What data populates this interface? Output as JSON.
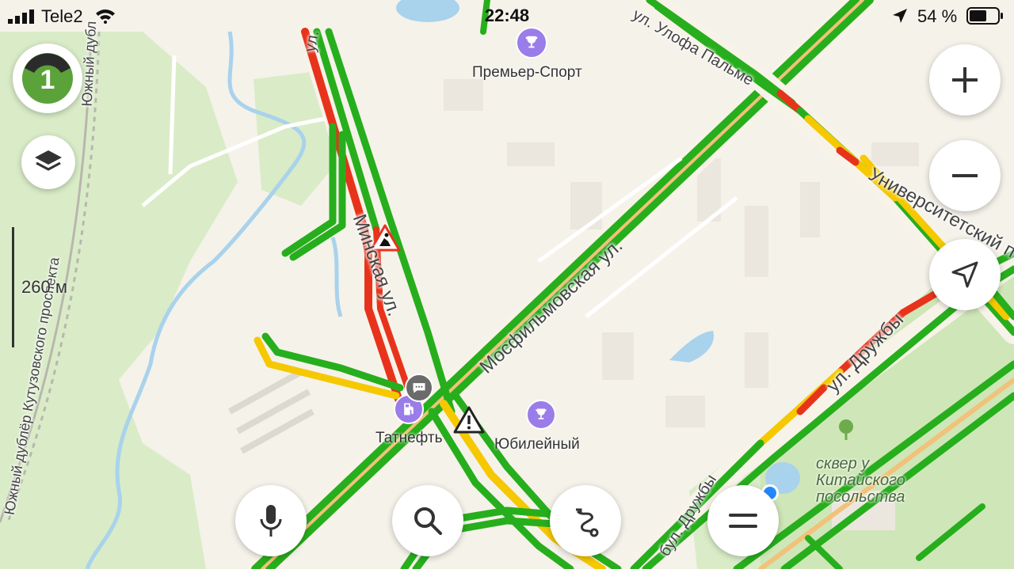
{
  "status_bar": {
    "carrier": "Tele2",
    "time": "22:48",
    "battery": "54 %"
  },
  "traffic_badge": {
    "level": "1"
  },
  "scale": {
    "label": "260 м"
  },
  "pois": {
    "premier_sport": "Премьер-Спорт",
    "tatneft": "Татнефть",
    "yubileyny": "Юбилейный",
    "park_line1": "сквер у",
    "park_line2": "Китайского",
    "park_line3": "посольства"
  },
  "streets": {
    "mosfilmovskaya": "Мосфильмовская ул.",
    "minskaya": "Минская ул.",
    "universitetsky": "Университетский п",
    "ul_druzhby": "ул. Дружбы",
    "bul_druzhby": "бул. Дружбы",
    "olof_palme": "ул. Улофа Пальме",
    "kutuzovsky_dubler": "Южный дублёр Кутузовского проспекта",
    "yuzhny_dubler": "Южный дубл",
    "ul_top": "ул."
  },
  "colors": {
    "traffic_green": "#27ae1d",
    "traffic_yellow": "#f5c800",
    "traffic_red": "#e8331c",
    "traffic_darkred": "#b51b0e",
    "poi_purple": "#9a7de8",
    "map_bg": "#f5f2ea",
    "park": "#d9ecc7",
    "water": "#a9d2ec",
    "location_dot": "#2389ff"
  },
  "icons": {
    "traffic": "traffic-level-icon",
    "layers": "layers-icon",
    "zoom_in": "plus-icon",
    "zoom_out": "minus-icon",
    "locate": "navigation-arrow-icon",
    "voice": "microphone-icon",
    "search": "search-icon",
    "route": "route-icon",
    "menu": "menu-icon"
  }
}
